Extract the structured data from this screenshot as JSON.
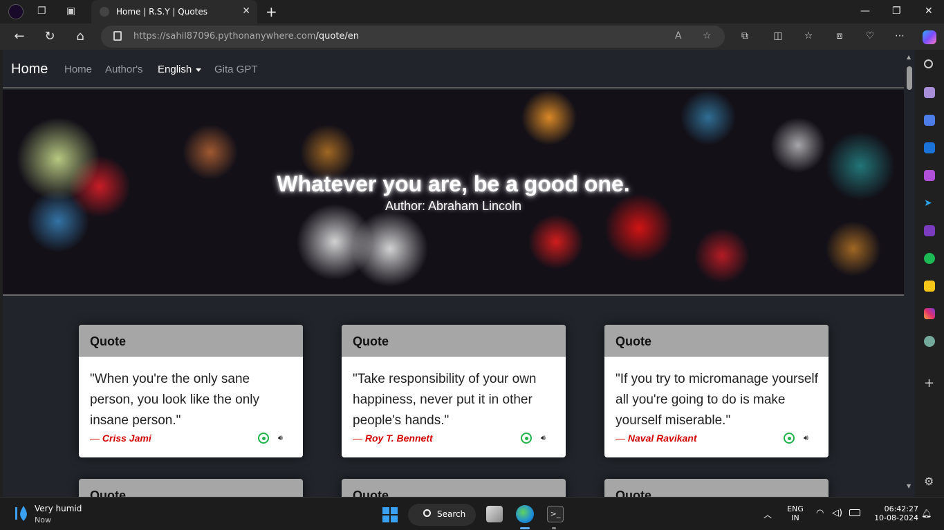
{
  "browser": {
    "tab_title": "Home | R.S.Y | Quotes",
    "url_host": "https://sahil87096.pythonanywhere.com",
    "url_path": "/quote/en"
  },
  "site": {
    "brand": "Home",
    "nav": [
      {
        "label": "Home"
      },
      {
        "label": "Author's"
      },
      {
        "label": "English"
      },
      {
        "label": "Gita GPT"
      }
    ]
  },
  "hero": {
    "quote": "Whatever you are, be a good one.",
    "author": "Author: Abraham Lincoln"
  },
  "cards": [
    {
      "header": "Quote",
      "text": "\"When you're the only sane person, you look like the only insane person.\"",
      "dash": "—",
      "author": "Criss Jami"
    },
    {
      "header": "Quote",
      "text": "\"Take responsibility of your own happiness, never put it in other people's hands.\"",
      "dash": "—",
      "author": "Roy T. Bennett"
    },
    {
      "header": "Quote",
      "text": "\"If you try to micromanage yourself all you're going to do is make yourself miserable.\"",
      "dash": "—",
      "author": "Naval Ravikant"
    }
  ],
  "cards_row2": [
    {
      "header": "Quote"
    },
    {
      "header": "Quote"
    },
    {
      "header": "Quote"
    }
  ],
  "taskbar": {
    "weather_title": "Very humid",
    "weather_sub": "Now",
    "search_label": "Search",
    "lang_line1": "ENG",
    "lang_line2": "IN",
    "time": "06:42:27",
    "date": "10-08-2024"
  },
  "colors": {
    "page_bg": "#21252b",
    "author_red": "#d40000",
    "card_header": "#a6a6a6",
    "whatsapp_green": "#1fb34a"
  },
  "icons": [
    "profile-icon",
    "workspaces-icon",
    "tab-actions-icon",
    "back-icon",
    "refresh-icon",
    "home-icon",
    "lock-icon",
    "read-aloud-icon",
    "favorite-icon",
    "extensions-icon",
    "split-screen-icon",
    "favorites-icon",
    "collections-icon",
    "browser-essentials-icon",
    "more-icon",
    "copilot-icon",
    "whatsapp-icon",
    "speaker-icon",
    "weather-icon",
    "windows-icon",
    "search-icon",
    "wifi-icon",
    "volume-icon",
    "battery-icon",
    "notification-icon"
  ]
}
